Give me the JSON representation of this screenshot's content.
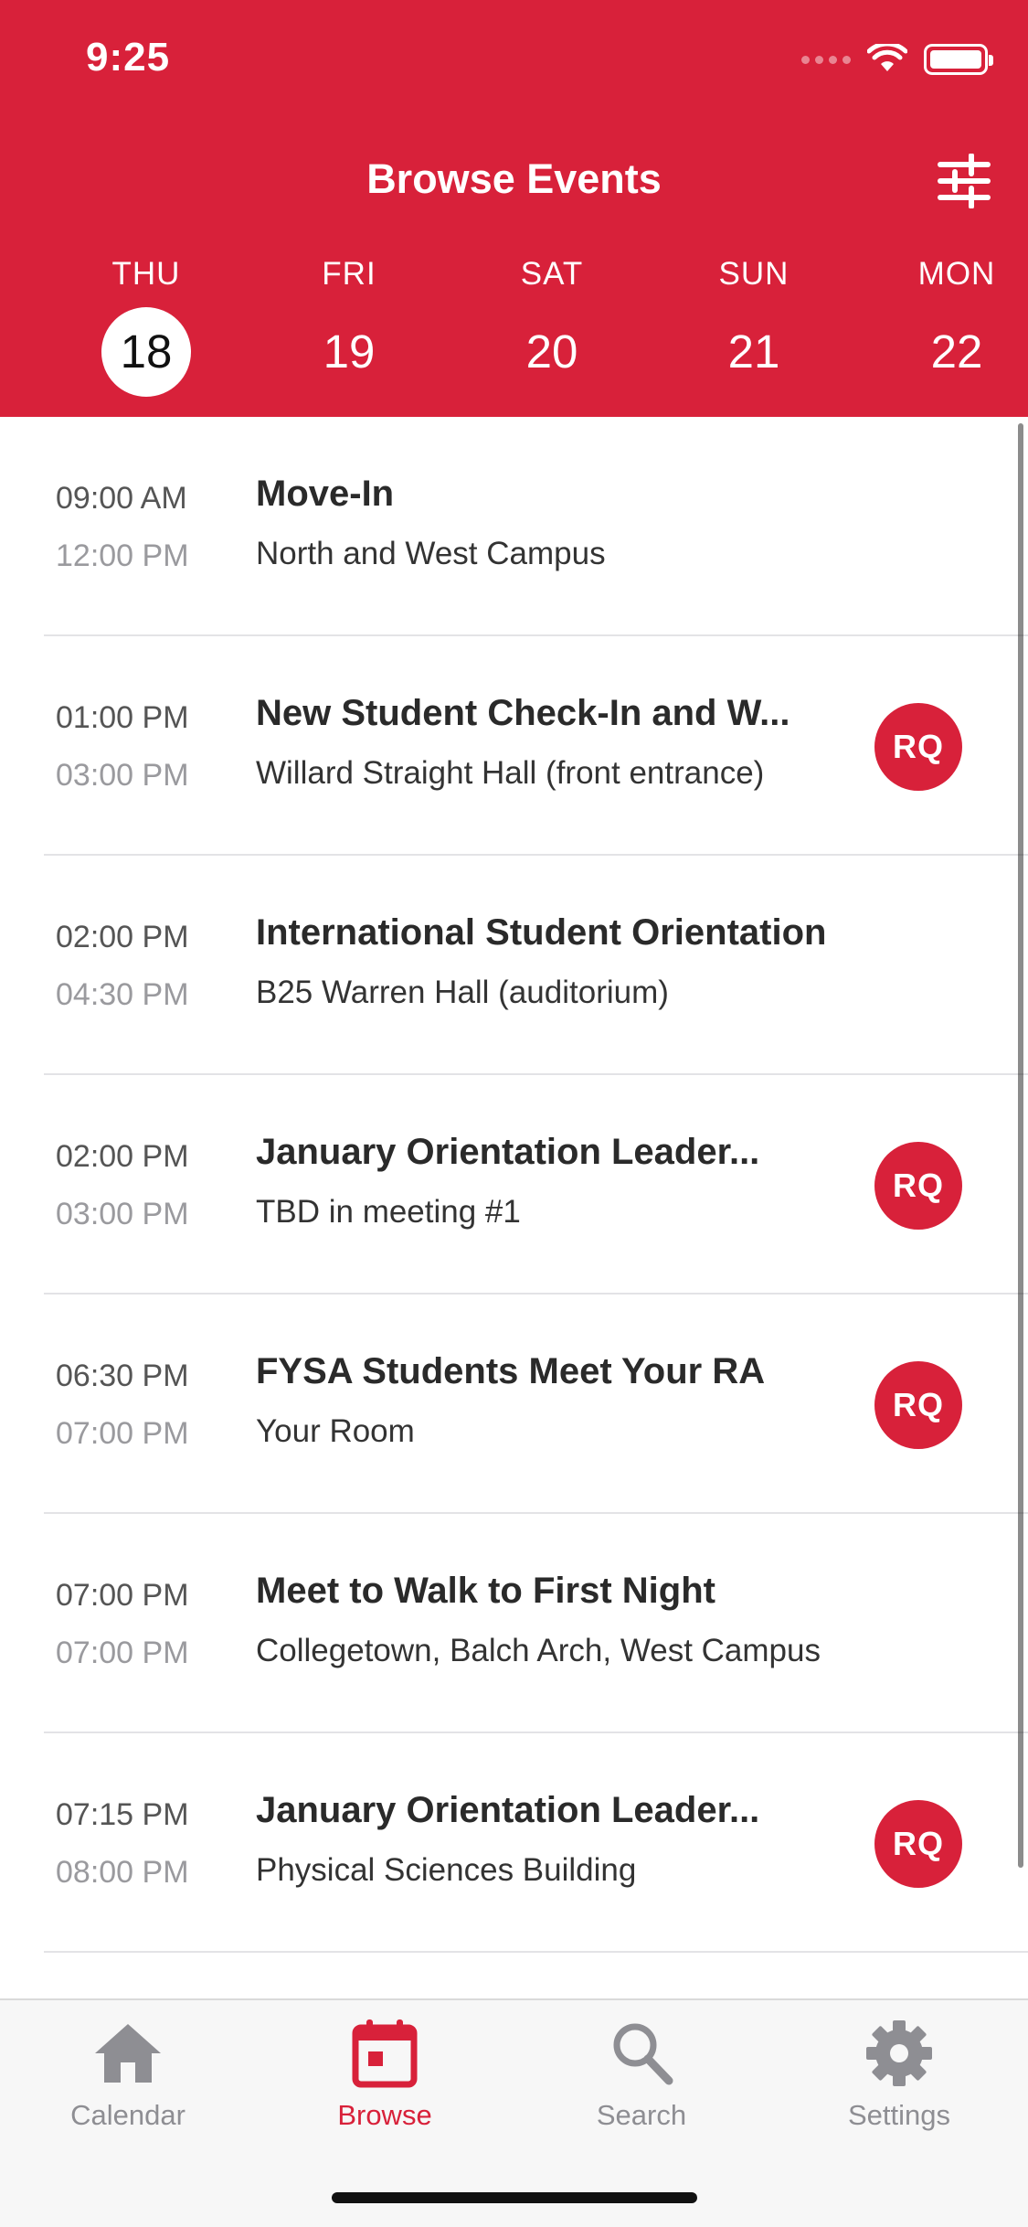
{
  "status_bar": {
    "time": "9:25"
  },
  "header": {
    "title": "Browse Events",
    "filter_icon": "sliders-icon",
    "accent_color": "#D8213A"
  },
  "days": [
    {
      "dow": "THU",
      "num": "18",
      "selected": true
    },
    {
      "dow": "FRI",
      "num": "19",
      "selected": false
    },
    {
      "dow": "SAT",
      "num": "20",
      "selected": false
    },
    {
      "dow": "SUN",
      "num": "21",
      "selected": false
    },
    {
      "dow": "MON",
      "num": "22",
      "selected": false
    }
  ],
  "events": [
    {
      "start": "09:00 AM",
      "end": "12:00 PM",
      "title": "Move-In",
      "location": "North and West Campus",
      "badge": ""
    },
    {
      "start": "01:00 PM",
      "end": "03:00 PM",
      "title": "New Student Check-In and W...",
      "location": "Willard Straight Hall (front entrance)",
      "badge": "RQ"
    },
    {
      "start": "02:00 PM",
      "end": "04:30 PM",
      "title": "International Student Orientation",
      "location": "B25 Warren Hall (auditorium)",
      "badge": ""
    },
    {
      "start": "02:00 PM",
      "end": "03:00 PM",
      "title": "January Orientation Leader...",
      "location": "TBD in meeting #1",
      "badge": "RQ"
    },
    {
      "start": "06:30 PM",
      "end": "07:00 PM",
      "title": "FYSA Students Meet Your RA",
      "location": "Your Room",
      "badge": "RQ"
    },
    {
      "start": "07:00 PM",
      "end": "07:00 PM",
      "title": "Meet to Walk to First Night",
      "location": "Collegetown, Balch Arch, West Campus",
      "badge": ""
    },
    {
      "start": "07:15 PM",
      "end": "08:00 PM",
      "title": "January Orientation Leader...",
      "location": "Physical Sciences Building",
      "badge": "RQ"
    }
  ],
  "tabs": [
    {
      "label": "Calendar",
      "icon": "house-icon",
      "active": false
    },
    {
      "label": "Browse",
      "icon": "calendar-icon",
      "active": true
    },
    {
      "label": "Search",
      "icon": "search-icon",
      "active": false
    },
    {
      "label": "Settings",
      "icon": "gear-icon",
      "active": false
    }
  ]
}
